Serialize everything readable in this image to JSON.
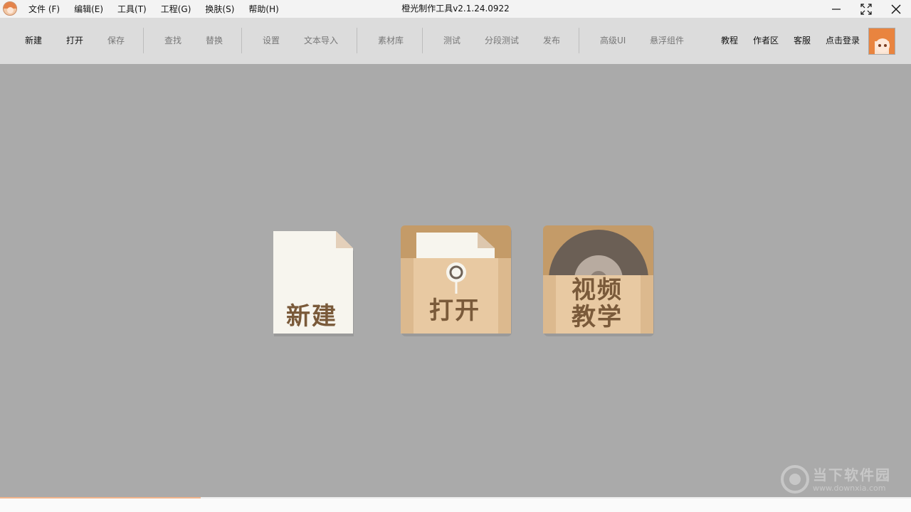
{
  "window": {
    "title": "橙光制作工具v2.1.24.0922",
    "app_icon": "app-avatar-icon",
    "controls": [
      "minimize-icon",
      "maximize-icon",
      "close-icon"
    ]
  },
  "menu": {
    "items": [
      "文件 (F)",
      "编辑(E)",
      "工具(T)",
      "工程(G)",
      "换肤(S)",
      "帮助(H)"
    ]
  },
  "toolbar": {
    "new": "新建",
    "open": "打开",
    "save": "保存",
    "find": "查找",
    "replace": "替换",
    "settings": "设置",
    "text_import": "文本导入",
    "asset_library": "素材库",
    "test": "测试",
    "segment_test": "分段测试",
    "publish": "发布",
    "advanced_ui": "高级UI",
    "floating_widget": "悬浮组件",
    "tutorial": "教程",
    "author_zone": "作者区",
    "support": "客服",
    "login": "点击登录"
  },
  "tiles": {
    "new_label": "新建",
    "open_label": "打开",
    "video_label_line1": "视频",
    "video_label_line2": "教学"
  },
  "watermark": {
    "text": "当下软件园",
    "url": "www.downxia.com"
  },
  "colors": {
    "workspace_bg": "#aaaaaa",
    "toolbar_bg": "#dcdcdc",
    "tile_brown": "#c49b68",
    "tile_tan": "#e8c9a2",
    "label_brown": "#7a5a3a"
  },
  "progress": {
    "fraction": 0.22
  }
}
